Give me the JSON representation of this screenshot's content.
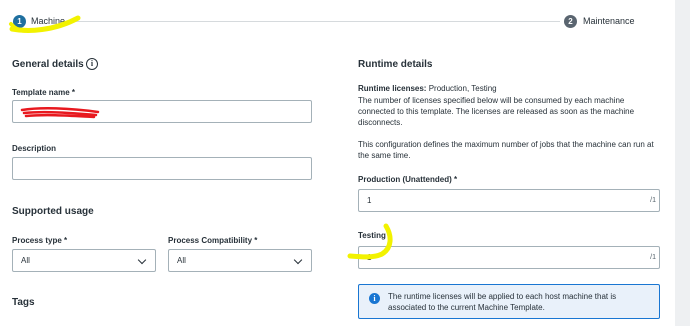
{
  "stepper": {
    "step1": {
      "number": "1",
      "label": "Machine"
    },
    "step2": {
      "number": "2",
      "label": "Maintenance"
    }
  },
  "general": {
    "heading": "General details",
    "info_icon_glyph": "i",
    "template_name": {
      "label": "Template name *",
      "value": ""
    },
    "description": {
      "label": "Description",
      "value": ""
    }
  },
  "supported_usage": {
    "heading": "Supported usage",
    "process_type": {
      "label": "Process type *",
      "value": "All"
    },
    "process_compatibility": {
      "label": "Process Compatibility *",
      "value": "All"
    }
  },
  "tags": {
    "heading": "Tags"
  },
  "runtime": {
    "heading": "Runtime details",
    "licenses_label": "Runtime licenses:",
    "licenses_value": "Production, Testing",
    "licenses_desc": "The number of licenses specified below will be consumed by each machine connected to this template. The licenses are released as soon as the machine disconnects.",
    "config_desc": "This configuration defines the maximum number of jobs that the machine can run at the same time.",
    "production": {
      "label": "Production (Unattended) *",
      "value": "1",
      "suffix": "/1"
    },
    "testing": {
      "label": "Testing *",
      "value": "1",
      "suffix": "/1"
    },
    "info": {
      "icon_glyph": "i",
      "text": "The runtime licenses will be applied to each host machine that is associated to the current Machine Template."
    }
  },
  "colors": {
    "accent": "#1f6f9f",
    "highlighter": "#f2f200",
    "redaction": "#e8191f",
    "info_border": "#1976d2"
  }
}
